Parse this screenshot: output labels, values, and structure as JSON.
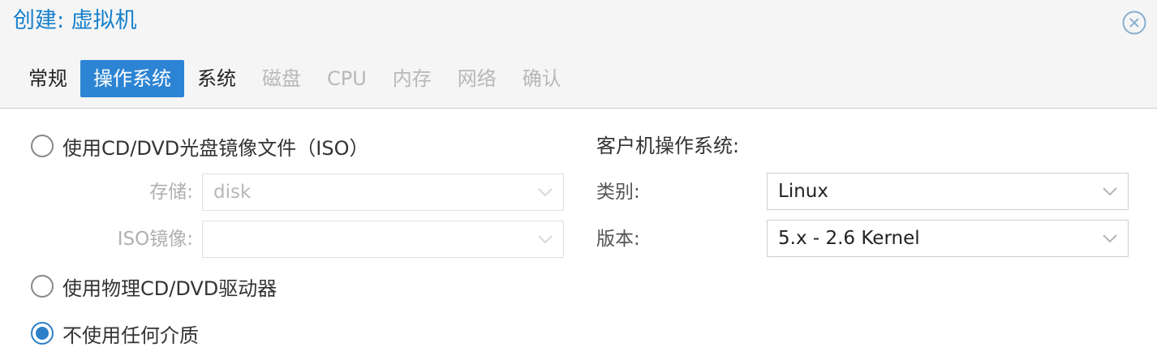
{
  "window": {
    "title": "创建: 虚拟机",
    "close_icon": "close-circle-icon"
  },
  "tabs": [
    {
      "label": "常规",
      "state": "normal"
    },
    {
      "label": "操作系统",
      "state": "active"
    },
    {
      "label": "系统",
      "state": "normal"
    },
    {
      "label": "磁盘",
      "state": "disabled"
    },
    {
      "label": "CPU",
      "state": "disabled"
    },
    {
      "label": "内存",
      "state": "disabled"
    },
    {
      "label": "网络",
      "state": "disabled"
    },
    {
      "label": "确认",
      "state": "disabled"
    }
  ],
  "media": {
    "iso_option": {
      "label": "使用CD/DVD光盘镜像文件（ISO）",
      "checked": false
    },
    "storage": {
      "label": "存储:",
      "value": "disk"
    },
    "iso_image": {
      "label": "ISO镜像:",
      "value": ""
    },
    "physical_option": {
      "label": "使用物理CD/DVD驱动器",
      "checked": false
    },
    "none_option": {
      "label": "不使用任何介质",
      "checked": true
    }
  },
  "guest_os": {
    "heading": "客户机操作系统:",
    "type": {
      "label": "类别:",
      "value": "Linux"
    },
    "version": {
      "label": "版本:",
      "value": "5.x - 2.6 Kernel"
    }
  },
  "colors": {
    "accent": "#2d84d4",
    "title": "#157fcc",
    "disabled": "#b8b8b8"
  }
}
